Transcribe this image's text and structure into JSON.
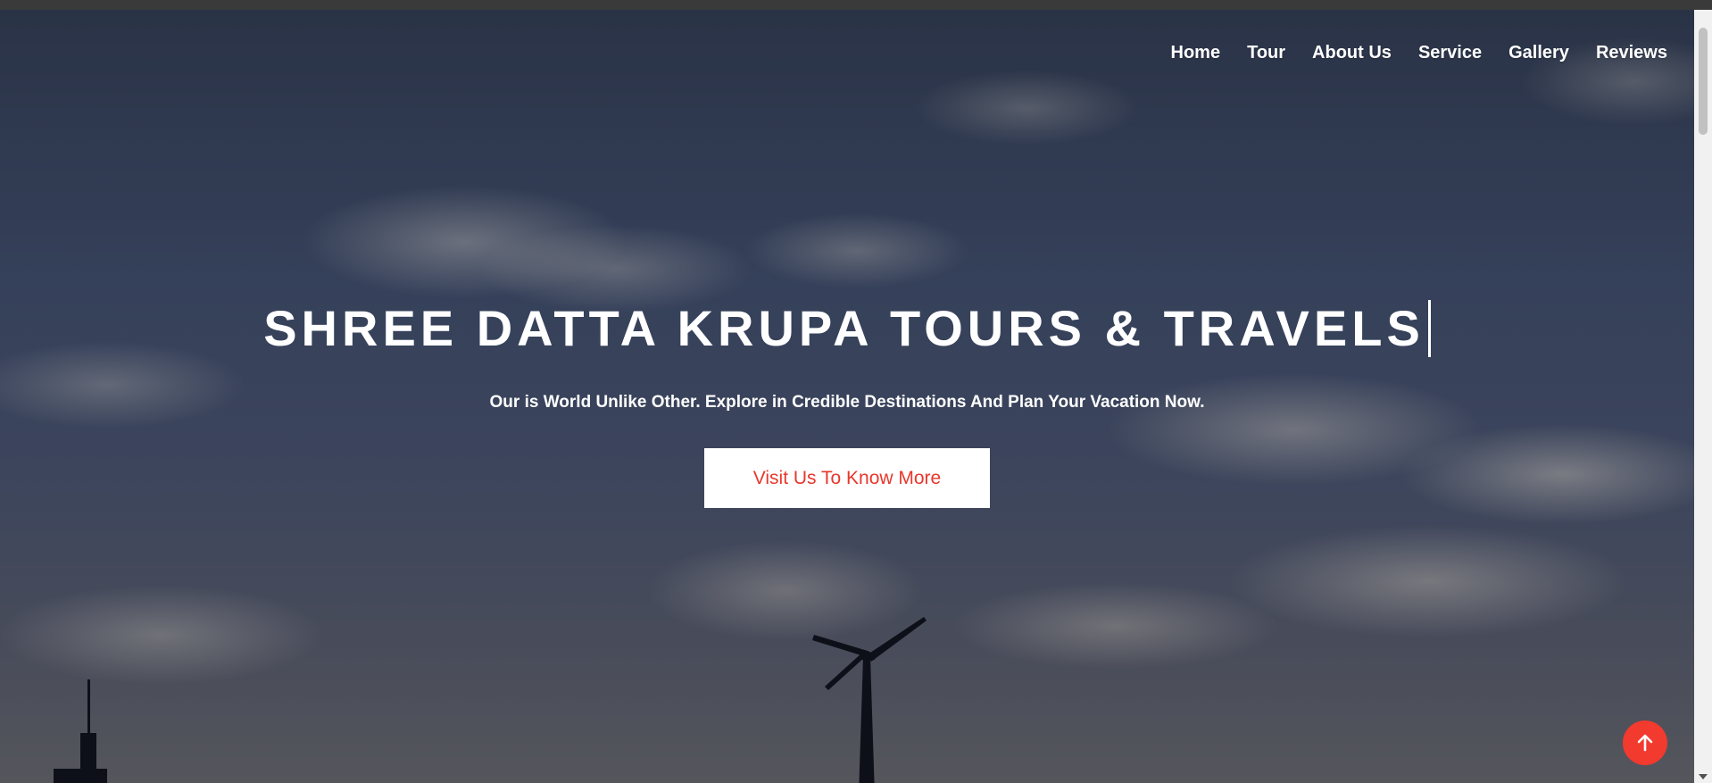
{
  "nav": {
    "items": [
      {
        "label": "Home"
      },
      {
        "label": "Tour"
      },
      {
        "label": "About Us"
      },
      {
        "label": "Service"
      },
      {
        "label": "Gallery"
      },
      {
        "label": "Reviews"
      }
    ]
  },
  "hero": {
    "title": "SHREE DATTA KRUPA TOURS & TRAVELS",
    "subtitle": "Our is World Unlike Other. Explore in Credible Destinations And Plan Your Vacation Now.",
    "cta_label": "Visit Us To Know More"
  },
  "scroll_top": {
    "icon": "arrow-up-icon"
  },
  "colors": {
    "accent": "#f23a2f",
    "cta_text": "#e8372c",
    "nav_text": "#ffffff"
  }
}
